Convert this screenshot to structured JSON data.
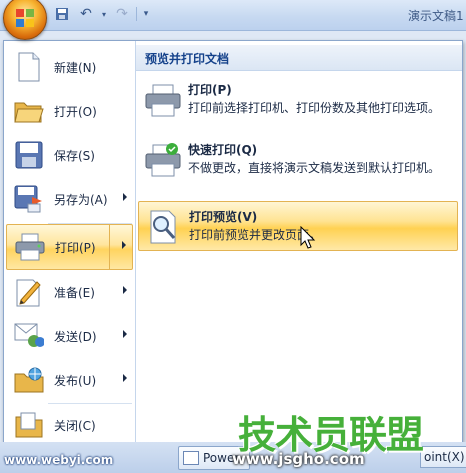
{
  "window": {
    "title": "演示文稿1"
  },
  "quick_access": {
    "save_icon": "save-icon",
    "undo_icon": "undo-icon",
    "redo_icon": "redo-icon",
    "customize_icon": "customize-icon"
  },
  "menu": {
    "items": [
      {
        "label": "新建(N)",
        "icon": "new-document-icon",
        "submenu": false
      },
      {
        "label": "打开(O)",
        "icon": "open-folder-icon",
        "submenu": false
      },
      {
        "label": "保存(S)",
        "icon": "save-disk-icon",
        "submenu": false
      },
      {
        "label": "另存为(A)",
        "icon": "save-as-icon",
        "submenu": true
      },
      {
        "label": "打印(P)",
        "icon": "printer-icon",
        "submenu": true,
        "active": true
      },
      {
        "label": "准备(E)",
        "icon": "prepare-icon",
        "submenu": true
      },
      {
        "label": "发送(D)",
        "icon": "send-icon",
        "submenu": true
      },
      {
        "label": "发布(U)",
        "icon": "publish-icon",
        "submenu": true
      },
      {
        "label": "关闭(C)",
        "icon": "close-folder-icon",
        "submenu": false
      }
    ]
  },
  "panel": {
    "header": "预览并打印文档",
    "options": [
      {
        "title": "打印(P)",
        "desc": "打印前选择打印机、打印份数及其他打印选项。"
      },
      {
        "title": "快速打印(Q)",
        "desc": "不做更改，直接将演示文稿发送到默认打印机。"
      },
      {
        "title": "打印预览(V)",
        "desc": "打印前预览并更改页面。"
      }
    ]
  },
  "taskbar": {
    "left_text": "www.webyi.com",
    "button1": "Power",
    "button2": "oint(X)"
  },
  "watermark": {
    "title": "技术员联盟",
    "url": "www.jsgho.com"
  },
  "colors": {
    "accent": "#ffd45f",
    "header_text": "#15428b",
    "watermark_green": "#46b03a"
  }
}
